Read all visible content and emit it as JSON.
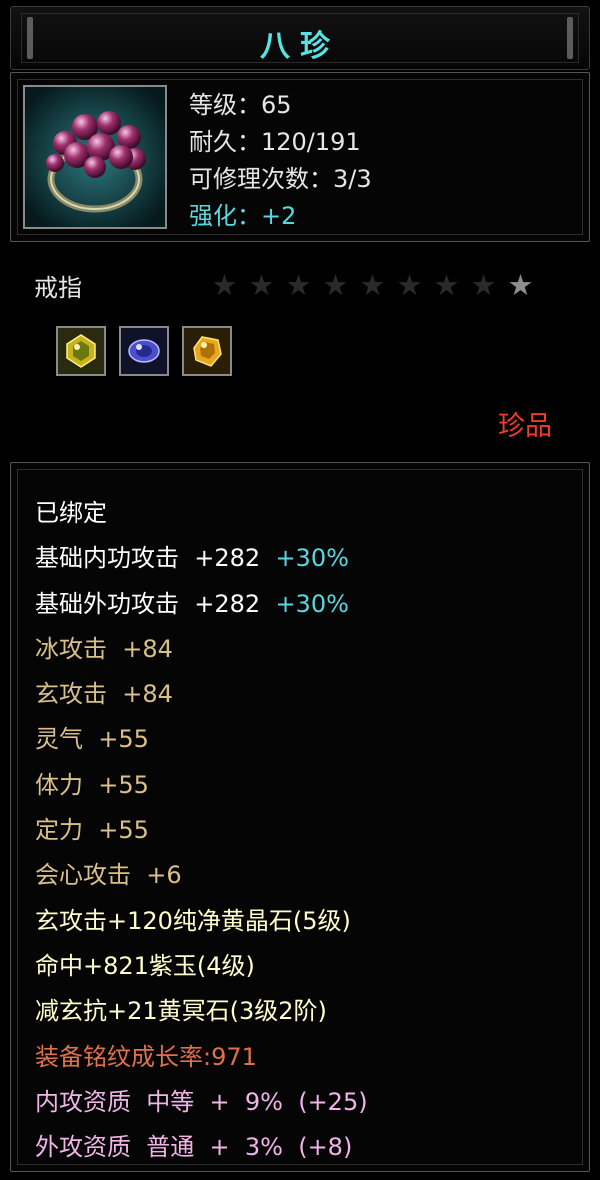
{
  "title": "八珍",
  "stats": [
    {
      "label": "等级：",
      "value": "65",
      "color": "#e6e6e6"
    },
    {
      "label": "耐久：",
      "value": "120/191",
      "color": "#e6e6e6"
    },
    {
      "label": "可修理次数：",
      "value": "3/3",
      "color": "#e6e6e6"
    },
    {
      "label": "强化：",
      "value": "+2",
      "color": "#56d8e0"
    }
  ],
  "item_type": "戒指",
  "stars": {
    "total": 9,
    "lit": 1
  },
  "gems": [
    "yellow-gem-icon",
    "blue-gem-icon",
    "gold-gem-icon"
  ],
  "quality": "珍品",
  "attributes": [
    {
      "name": "已绑定",
      "value": "",
      "extra": "",
      "color": "#ffffff"
    },
    {
      "name": "基础内功攻击",
      "value": "  +282  ",
      "extra": "+30%",
      "color": "#ffffff",
      "extra_color": "#56d8e0"
    },
    {
      "name": "基础外功攻击",
      "value": "  +282  ",
      "extra": "+30%",
      "color": "#ffffff",
      "extra_color": "#56d8e0"
    },
    {
      "name": "冰攻击",
      "value": "  +84",
      "extra": "",
      "color": "#d9c088"
    },
    {
      "name": "玄攻击",
      "value": "  +84",
      "extra": "",
      "color": "#d9c088"
    },
    {
      "name": "灵气",
      "value": "  +55",
      "extra": "",
      "color": "#d9c088"
    },
    {
      "name": "体力",
      "value": "  +55",
      "extra": "",
      "color": "#d9c088"
    },
    {
      "name": "定力",
      "value": "  +55",
      "extra": "",
      "color": "#d9c088"
    },
    {
      "name": "会心攻击",
      "value": "  +6",
      "extra": "",
      "color": "#d9c088"
    },
    {
      "name": "玄攻击",
      "value": "+120纯净黄晶石(5级)",
      "extra": "",
      "color": "#ffffcc"
    },
    {
      "name": "命中",
      "value": "+821紫玉(4级)",
      "extra": "",
      "color": "#ffffcc"
    },
    {
      "name": "减玄抗",
      "value": "+21黄冥石(3级2阶)",
      "extra": "",
      "color": "#ffffcc"
    },
    {
      "name": "装备铭纹成长率:",
      "value": "971",
      "extra": "",
      "color": "#e0704c"
    },
    {
      "name": "内攻资质",
      "value": "  中等  +  9%  (+25)",
      "extra": "",
      "color": "#f0b4e8"
    },
    {
      "name": "外攻资质",
      "value": "  普通  +  3%  (+8)",
      "extra": "",
      "color": "#f0b4e8"
    }
  ],
  "colors": {
    "title": "#56e3e3",
    "quality": "#ef3b2c",
    "border": "#555555"
  }
}
